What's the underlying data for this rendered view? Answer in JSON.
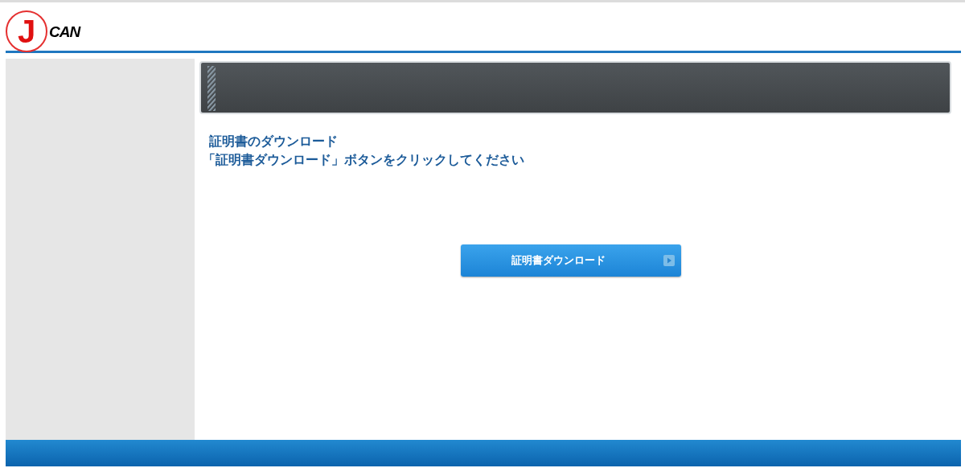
{
  "logo": {
    "mark": "J",
    "text": "CAN"
  },
  "heading": "証明書のダウンロード",
  "instruction": "「証明書ダウンロード」ボタンをクリックしてください",
  "download_button": {
    "label": "証明書ダウンロード"
  }
}
